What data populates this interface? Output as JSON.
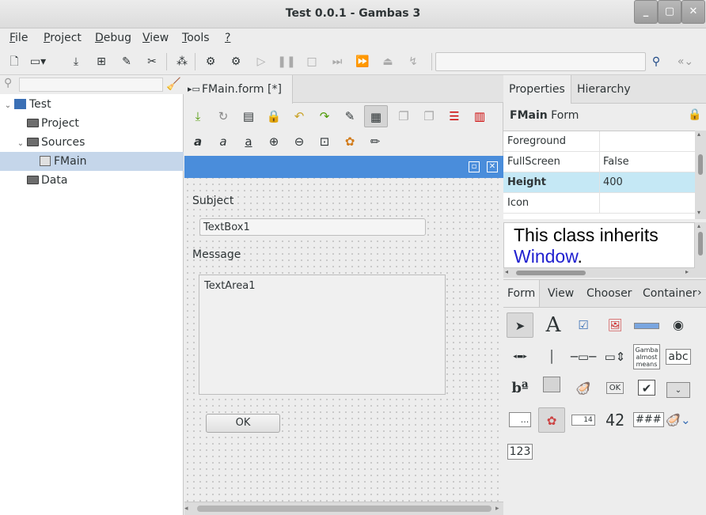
{
  "window": {
    "title": "Test 0.0.1 - Gambas 3"
  },
  "menu": {
    "items": [
      {
        "label": "File",
        "mnemonic": "F",
        "rest": "ile"
      },
      {
        "label": "Project",
        "mnemonic": "P",
        "rest": "roject"
      },
      {
        "label": "Debug",
        "mnemonic": "D",
        "rest": "ebug"
      },
      {
        "label": "View",
        "mnemonic": "V",
        "rest": "iew"
      },
      {
        "label": "Tools",
        "mnemonic": "T",
        "rest": "ools"
      },
      {
        "label": "?",
        "mnemonic": "?",
        "rest": ""
      }
    ]
  },
  "toolbar": {
    "search_value": "",
    "icons": [
      "new-project-icon",
      "open-project-icon",
      "save-project-icon",
      "make-executable-icon",
      "edit-icon",
      "properties-icon",
      "references-icon",
      "build-icon",
      "compile-all-icon",
      "run-icon",
      "pause-icon",
      "stop-icon",
      "step-into-icon",
      "step-over-icon",
      "step-out-icon",
      "break-icon",
      "search-icon",
      "back-icon"
    ]
  },
  "project_tree": {
    "filter_value": "",
    "items": [
      {
        "label": "Test",
        "level": 0,
        "expanded": "true"
      },
      {
        "label": "Project",
        "level": 1
      },
      {
        "label": "Sources",
        "level": 1,
        "expanded": "true"
      },
      {
        "label": "FMain",
        "level": 2,
        "selected": "true"
      },
      {
        "label": "Data",
        "level": 1
      }
    ]
  },
  "editor": {
    "tab_label": "FMain.form [*]",
    "form": {
      "subject_label": "Subject",
      "textbox_value": "TextBox1",
      "message_label": "Message",
      "textarea_value": "TextArea1",
      "ok_label": "OK"
    }
  },
  "properties_panel": {
    "tabs": [
      "Properties",
      "Hierarchy"
    ],
    "object_name": "FMain",
    "object_class": "Form",
    "rows": [
      {
        "key": "Foreground",
        "value": ""
      },
      {
        "key": "FullScreen",
        "value": "False"
      },
      {
        "key": "Height",
        "value": "400",
        "selected": "true"
      },
      {
        "key": "Icon",
        "value": ""
      }
    ],
    "help_text": "This class inherits",
    "help_link": "Window",
    "help_after": "."
  },
  "toolbox": {
    "tabs": [
      "Form",
      "View",
      "Chooser",
      "Container"
    ],
    "labels": {
      "ok": "OK",
      "gamba": "Gamba almost means",
      "abc": "abc",
      "num42": "42",
      "hash": "###",
      "n123": "123",
      "dots": "...",
      "cal": "14",
      "A": "A"
    }
  },
  "colors": {
    "accent": "#4a8ddb",
    "selection": "#c5d6ea",
    "prop_selection": "#c5e8f5",
    "link": "#2020d0"
  }
}
